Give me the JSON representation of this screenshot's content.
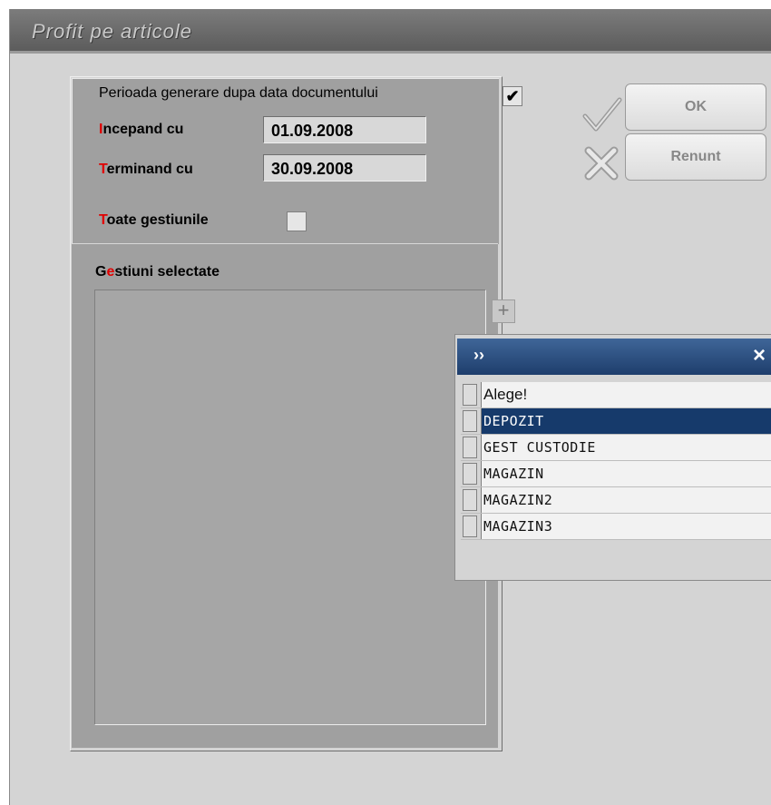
{
  "window": {
    "title": "Profit pe articole"
  },
  "form": {
    "period_label": "Perioada generare dupa data documentului",
    "period_checked": true,
    "start_label_accent": "I",
    "start_label_rest": "ncepand cu",
    "start_value": "01.09.2008",
    "end_label_accent": "T",
    "end_label_rest": "erminand cu",
    "end_value": "30.09.2008",
    "all_label_accent": "T",
    "all_label_rest": "oate gestiunile",
    "all_checked": false,
    "selected_label_first": "G",
    "selected_label_accent": "e",
    "selected_label_rest": "stiuni selectate",
    "add_button": "+"
  },
  "buttons": {
    "ok_label": "OK",
    "cancel_label": "Renunt"
  },
  "popup": {
    "title": "››",
    "close": "×",
    "header": "Alege!",
    "items": [
      "DEPOZIT",
      "GEST CUSTODIE",
      "MAGAZIN",
      "MAGAZIN2",
      "MAGAZIN3"
    ],
    "selected_index": 0
  },
  "icons": {
    "ok": "checkmark-icon",
    "cancel": "cross-icon",
    "close": "close-icon"
  }
}
